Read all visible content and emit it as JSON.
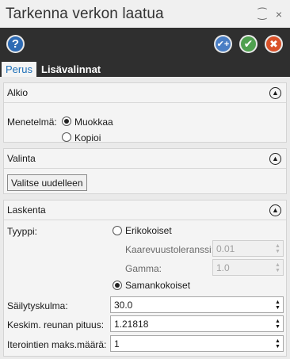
{
  "window": {
    "title": "Tarkenna verkon laatua",
    "pin_glyph": "⁐",
    "close_glyph": "×"
  },
  "toolbar": {
    "help_glyph": "?",
    "apply_glyph": "✔+",
    "ok_glyph": "✔",
    "cancel_glyph": "✖"
  },
  "tabs": [
    {
      "label": "Perus",
      "active": true
    },
    {
      "label": "Lisävalinnat",
      "active": false
    }
  ],
  "sections": {
    "alkio": {
      "title": "Alkio",
      "method_label": "Menetelmä:",
      "options": [
        {
          "label": "Muokkaa",
          "selected": true
        },
        {
          "label": "Kopioi",
          "selected": false
        }
      ]
    },
    "valinta": {
      "title": "Valinta",
      "reselect_label": "Valitse uudelleen"
    },
    "laskenta": {
      "title": "Laskenta",
      "type_label": "Tyyppi:",
      "option_varied": "Erikokoiset",
      "option_uniform": "Samankokoiset",
      "uniform_selected": true,
      "curvature_label": "Kaarevuustoleranssi:",
      "curvature_value": "0.01",
      "gamma_label": "Gamma:",
      "gamma_value": "1.0",
      "retention_angle_label": "Säilytyskulma:",
      "retention_angle_value": "30.0",
      "avg_edge_label": "Keskim. reunan pituus:",
      "avg_edge_value": "1.21818",
      "max_iter_label": "Iterointien maks.määrä:",
      "max_iter_value": "1"
    }
  },
  "icons": {
    "collapse_glyph": "▲",
    "spin_glyph": "▲\n▼"
  }
}
